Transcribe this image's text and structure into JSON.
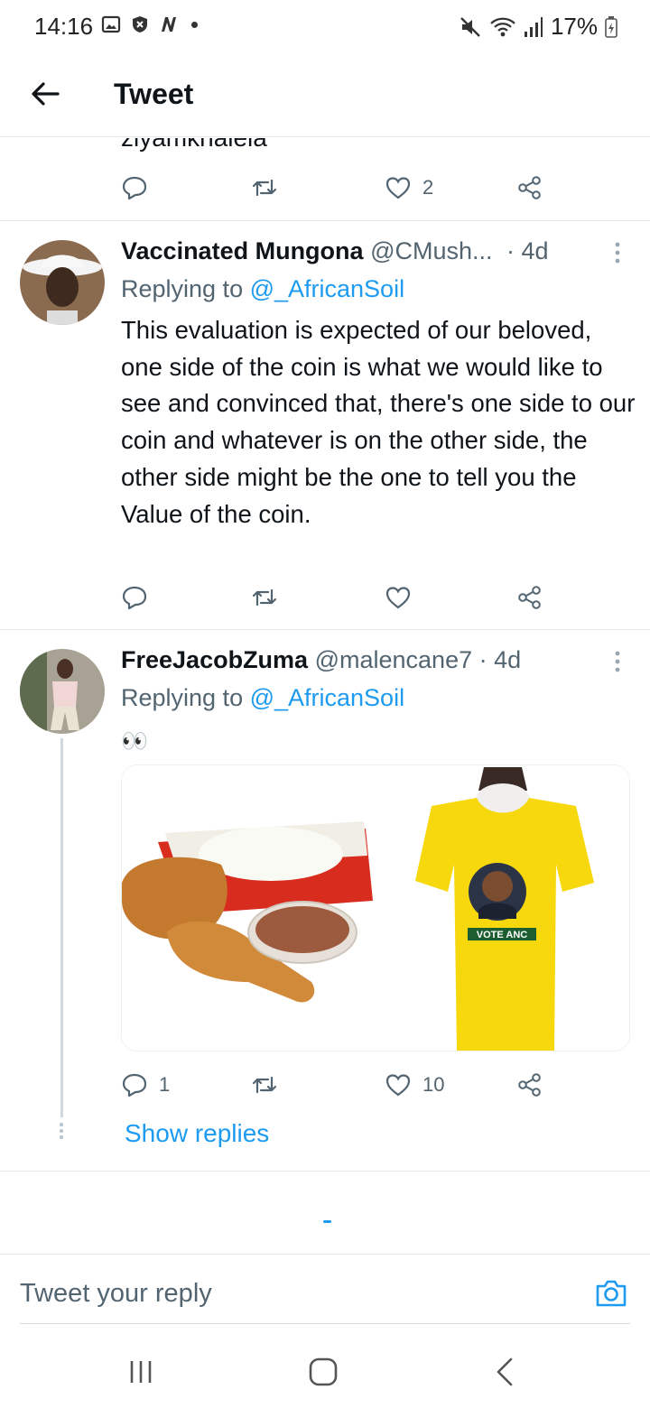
{
  "status_bar": {
    "time": "14:16",
    "battery": "17%",
    "left_icons": [
      "gallery-icon",
      "shield-icon",
      "n-app-icon",
      "notification-dot"
    ],
    "right_icons": [
      "mute-icon",
      "wifi-icon",
      "signal-icon",
      "battery-charging-icon"
    ]
  },
  "header": {
    "title": "Tweet"
  },
  "partial_tweet": {
    "text": "ziyamkhalela",
    "actions": {
      "replies": "",
      "retweets": "",
      "likes": "2"
    }
  },
  "tweets": [
    {
      "name": "Vaccinated Mungona",
      "handle": "@CMush...",
      "time": "· 4d",
      "replying_prefix": "Replying to ",
      "replying_to": "@_AfricanSoil",
      "text": "This evaluation is expected of our beloved, one side of the coin is what we would like to see and convinced that, there's one side to our coin and whatever is on the other side, the other side might be the one to tell you the Value of the coin.",
      "actions": {
        "replies": "",
        "retweets": "",
        "likes": ""
      }
    },
    {
      "name": "FreeJacobZuma",
      "handle": "@malencane7",
      "time": "· 4d",
      "replying_prefix": "Replying to ",
      "replying_to": "@_AfricanSoil",
      "text": "👀",
      "media": [
        "fried-chicken-meal-image",
        "anc-yellow-tshirt-image"
      ],
      "shirt_text": "VOTE ANC",
      "actions": {
        "replies": "1",
        "retweets": "",
        "likes": "10"
      },
      "show_replies": "Show replies"
    }
  ],
  "composer": {
    "placeholder": "Tweet your reply"
  },
  "nav": [
    "recents-button",
    "home-button",
    "back-button"
  ],
  "colors": {
    "accent": "#1d9bf0",
    "text": "#0f1419",
    "muted": "#536471",
    "border": "#e6e9ec"
  }
}
